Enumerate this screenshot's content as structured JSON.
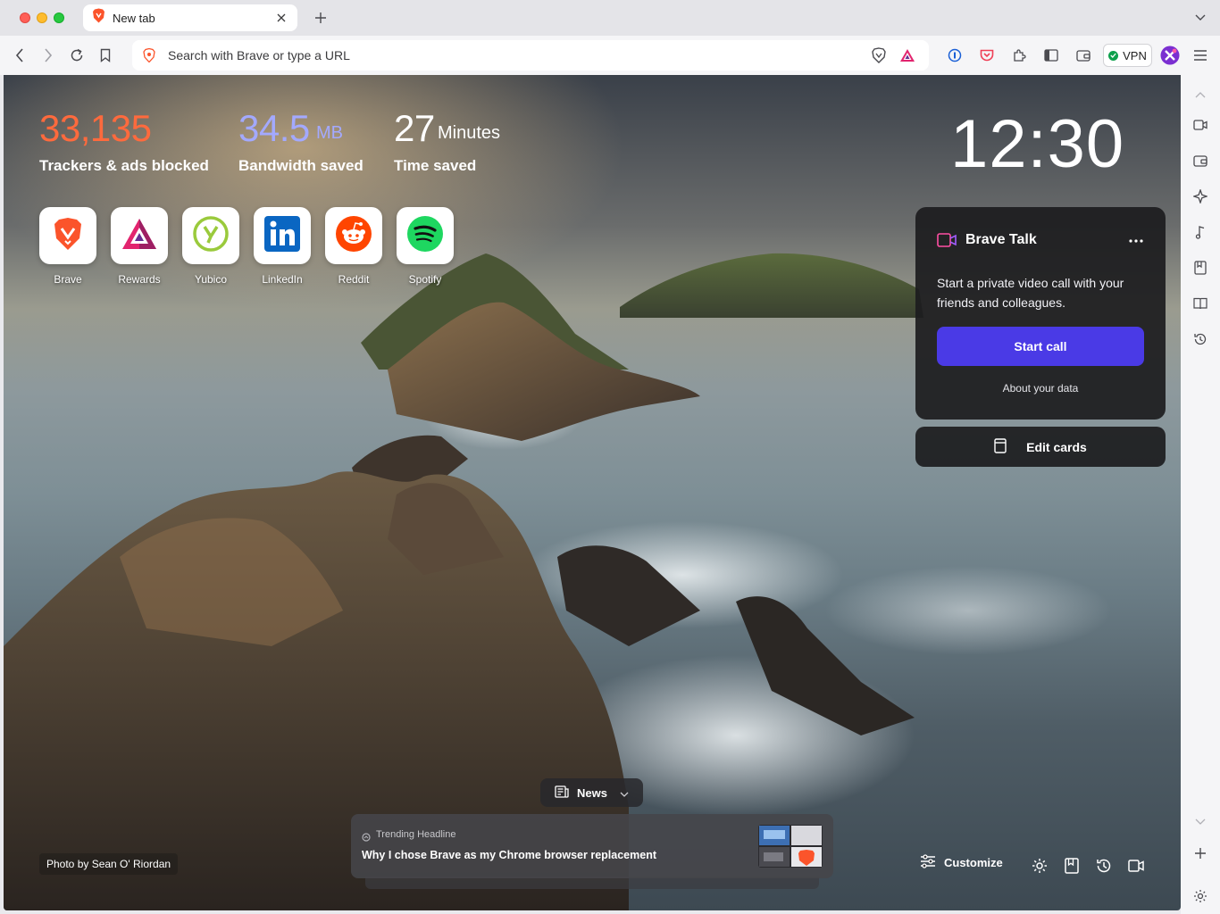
{
  "tab": {
    "title": "New tab"
  },
  "urlbar": {
    "placeholder": "Search with Brave or type a URL"
  },
  "toolbar": {
    "vpn_label": "VPN"
  },
  "stats": {
    "trackers": {
      "value": "33,135",
      "label": "Trackers & ads blocked",
      "color": "#ff6a3d"
    },
    "bandwidth": {
      "value": "34.5",
      "unit": "MB",
      "label": "Bandwidth saved",
      "color": "#a3a9ff"
    },
    "time": {
      "value": "27",
      "unit": "Minutes",
      "label": "Time saved",
      "color": "#ffffff"
    }
  },
  "top_sites": [
    {
      "label": "Brave",
      "icon": "brave-lion-icon"
    },
    {
      "label": "Rewards",
      "icon": "bat-triangle-icon"
    },
    {
      "label": "Yubico",
      "icon": "yubico-icon"
    },
    {
      "label": "LinkedIn",
      "icon": "linkedin-icon"
    },
    {
      "label": "Reddit",
      "icon": "reddit-icon"
    },
    {
      "label": "Spotify",
      "icon": "spotify-icon"
    }
  ],
  "clock": "12:30",
  "brave_talk": {
    "title": "Brave Talk",
    "description": "Start a private video call with your friends and colleagues.",
    "start_label": "Start call",
    "about_label": "About your data",
    "accent": "#4a3ae6"
  },
  "edit_cards_label": "Edit cards",
  "news": {
    "pill_label": "News",
    "kicker": "Trending Headline",
    "headline": "Why I chose Brave as my Chrome browser replacement"
  },
  "photo_credit": "Photo by Sean O' Riordan",
  "customize_label": "Customize"
}
